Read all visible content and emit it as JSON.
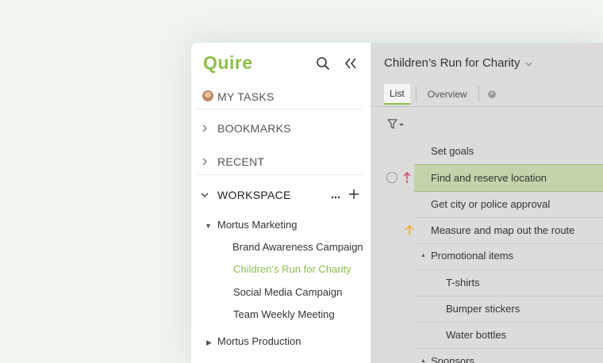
{
  "sidebar": {
    "logo": "Quire",
    "my_tasks": "MY TASKS",
    "bookmarks": "BOOKMARKS",
    "recent": "RECENT",
    "workspace": "WORKSPACE",
    "tree": [
      {
        "label": "Mortus Marketing"
      },
      {
        "label": "Brand Awareness Campaign"
      },
      {
        "label": "Children’s Run for Charity"
      },
      {
        "label": "Social Media Campaign"
      },
      {
        "label": "Team Weekly Meeting"
      },
      {
        "label": "Mortus Production"
      }
    ]
  },
  "main": {
    "project_title": "Children’s Run for Charity",
    "tabs": [
      {
        "label": "List"
      },
      {
        "label": "Overview"
      }
    ],
    "tasks": [
      {
        "title": "Set goals"
      },
      {
        "title": "Find and reserve location"
      },
      {
        "title": "Get city or police approval"
      },
      {
        "title": "Measure and map out the route"
      },
      {
        "title": "Promotional items"
      },
      {
        "title": "T-shirts"
      },
      {
        "title": "Bumper stickers"
      },
      {
        "title": "Water bottles"
      },
      {
        "title": "Sponsors"
      }
    ]
  },
  "colors": {
    "accent": "#8cbf4a",
    "selected_row": "#c3d3ab",
    "priority_urgent": "#d9416a",
    "priority_high": "#e8a42a"
  }
}
